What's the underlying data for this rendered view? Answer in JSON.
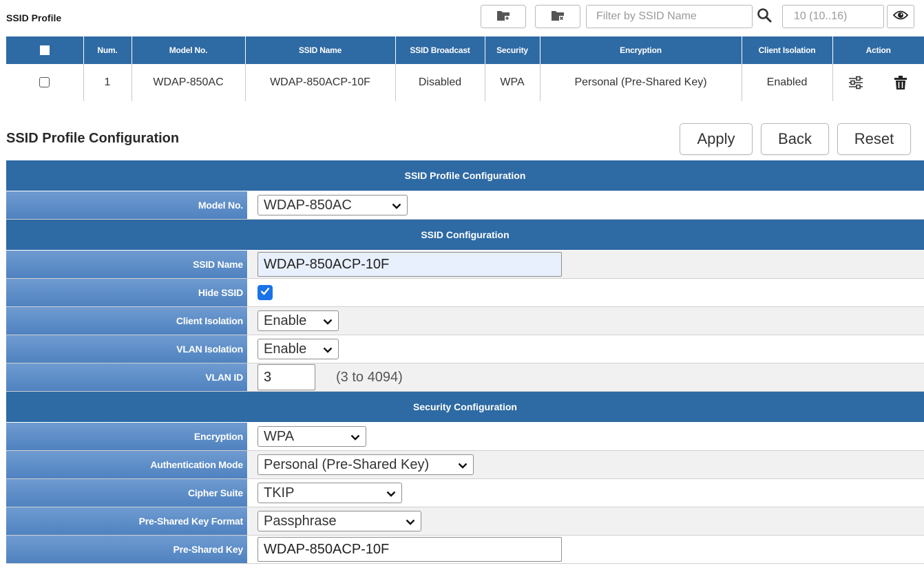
{
  "toolbar": {
    "title": "SSID Profile",
    "add_button_label": "Add profile",
    "delete_button_label": "Delete profile",
    "filter_placeholder": "Filter by SSID Name",
    "page_count": "10 (10..16)"
  },
  "profile_table": {
    "headers": [
      "",
      "Num.",
      "Model No.",
      "SSID Name",
      "SSID Broadcast",
      "Security",
      "Encryption",
      "Client Isolation",
      "Action"
    ],
    "rows": [
      {
        "num": "1",
        "model": "WDAP-850AC",
        "ssid_name": "WDAP-850ACP-10F",
        "broadcast": "Disabled",
        "security": "WPA",
        "encryption": "Personal (Pre-Shared Key)",
        "client_isolation": "Enabled"
      }
    ]
  },
  "config": {
    "title": "SSID Profile Configuration",
    "apply_label": "Apply",
    "back_label": "Back",
    "reset_label": "Reset",
    "sections": {
      "profile": "SSID Profile Configuration",
      "ssid": "SSID Configuration",
      "security": "Security Configuration"
    },
    "fields": {
      "model_no": {
        "label": "Model No.",
        "value": "WDAP-850AC"
      },
      "ssid_name": {
        "label": "SSID Name",
        "value": "WDAP-850ACP-10F"
      },
      "hide_ssid": {
        "label": "Hide SSID",
        "checked": true
      },
      "client_isolation": {
        "label": "Client Isolation",
        "value": "Enable"
      },
      "vlan_isolation": {
        "label": "VLAN Isolation",
        "value": "Enable"
      },
      "vlan_id": {
        "label": "VLAN ID",
        "value": "3",
        "hint": "(3 to 4094)"
      },
      "encryption": {
        "label": "Encryption",
        "value": "WPA"
      },
      "auth_mode": {
        "label": "Authentication Mode",
        "value": "Personal (Pre-Shared Key)"
      },
      "cipher_suite": {
        "label": "Cipher Suite",
        "value": "TKIP"
      },
      "psk_format": {
        "label": "Pre-Shared Key Format",
        "value": "Passphrase"
      },
      "psk": {
        "label": "Pre-Shared Key",
        "value": "WDAP-850ACP-10F"
      }
    }
  },
  "colors": {
    "header_blue": "#2e6aa4",
    "label_blue": "#5a8cc8",
    "checkbox_blue": "#1a73e8"
  },
  "icons": [
    "folder-add-icon",
    "folder-delete-icon",
    "search-icon",
    "eye-icon",
    "settings-sliders-icon",
    "trash-icon",
    "chevron-down-icon",
    "checkmark-icon"
  ]
}
